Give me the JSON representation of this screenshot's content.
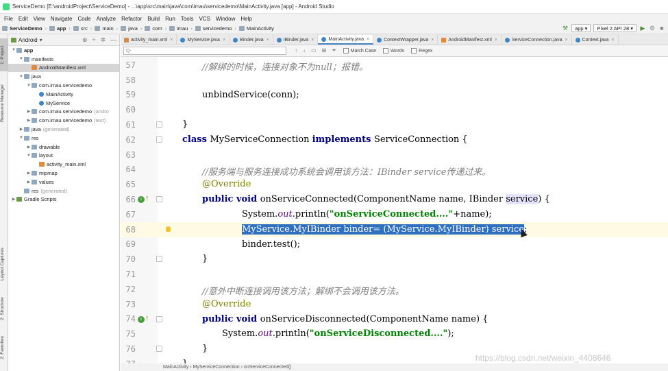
{
  "window": {
    "title": "ServiceDemo [E:\\androidProject\\ServiceDemo] - ...\\app\\src\\main\\java\\com\\imau\\servicedemo\\MainActivity.java [app] - Android Studio"
  },
  "menu": [
    "File",
    "Edit",
    "View",
    "Navigate",
    "Code",
    "Analyze",
    "Refactor",
    "Build",
    "Run",
    "Tools",
    "VCS",
    "Window",
    "Help"
  ],
  "breadcrumbs": [
    "ServiceDemo",
    "app",
    "src",
    "main",
    "java",
    "com",
    "imau",
    "servicedemo",
    "MainActivity"
  ],
  "toolbar": {
    "run_config": "app",
    "device": "Pixel 2 API 28"
  },
  "left_tools": [
    "1: Project",
    "Resource Manager",
    "Layout Captures",
    "2: Structure",
    "2: Favorites"
  ],
  "project_panel": {
    "view": "Android",
    "tree": [
      {
        "label": "app",
        "depth": 0,
        "arrow": "▼",
        "icon": "folder",
        "bold": true
      },
      {
        "label": "manifests",
        "depth": 1,
        "arrow": "▼",
        "icon": "folder"
      },
      {
        "label": "AndroidManifest.xml",
        "depth": 2,
        "arrow": "",
        "icon": "xml",
        "selected": true
      },
      {
        "label": "java",
        "depth": 1,
        "arrow": "▼",
        "icon": "folder"
      },
      {
        "label": "com.imau.servicedemo",
        "depth": 2,
        "arrow": "▼",
        "icon": "folder"
      },
      {
        "label": "MainActivity",
        "depth": 3,
        "arrow": "",
        "icon": "class"
      },
      {
        "label": "MyService",
        "depth": 3,
        "arrow": "",
        "icon": "class"
      },
      {
        "label": "com.imau.servicedemo",
        "suffix": "(andro",
        "depth": 2,
        "arrow": "▶",
        "icon": "folder"
      },
      {
        "label": "com.imau.servicedemo",
        "suffix": "(test)",
        "depth": 2,
        "arrow": "▶",
        "icon": "folder"
      },
      {
        "label": "java",
        "suffix": "(generated)",
        "depth": 1,
        "arrow": "▶",
        "icon": "folder"
      },
      {
        "label": "res",
        "depth": 1,
        "arrow": "▼",
        "icon": "folder"
      },
      {
        "label": "drawable",
        "depth": 2,
        "arrow": "▶",
        "icon": "folder"
      },
      {
        "label": "layout",
        "depth": 2,
        "arrow": "▼",
        "icon": "folder"
      },
      {
        "label": "activity_main.xml",
        "depth": 3,
        "arrow": "",
        "icon": "xml"
      },
      {
        "label": "mipmap",
        "depth": 2,
        "arrow": "▶",
        "icon": "folder"
      },
      {
        "label": "values",
        "depth": 2,
        "arrow": "▶",
        "icon": "folder"
      },
      {
        "label": "res",
        "suffix": "(generated)",
        "depth": 1,
        "arrow": "",
        "icon": "folder"
      },
      {
        "label": "Gradle Scripts",
        "depth": 0,
        "arrow": "▶",
        "icon": "gradle"
      }
    ]
  },
  "tabs": [
    {
      "label": "activity_main.xml",
      "icon": "xml",
      "active": false
    },
    {
      "label": "MyService.java",
      "icon": "class",
      "active": false
    },
    {
      "label": "Binder.java",
      "icon": "class",
      "active": false
    },
    {
      "label": "IBinder.java",
      "icon": "class",
      "active": false
    },
    {
      "label": "MainActivity.java",
      "icon": "class",
      "active": true
    },
    {
      "label": "ContextWrapper.java",
      "icon": "class",
      "active": false
    },
    {
      "label": "AndroidManifest.xml",
      "icon": "xml",
      "active": false
    },
    {
      "label": "ServiceConnection.java",
      "icon": "class",
      "active": false
    },
    {
      "label": "Context.java",
      "icon": "class",
      "active": false
    }
  ],
  "search": {
    "placeholder": "Q-",
    "match_case": "Match Case",
    "words": "Words",
    "regex": "Regex"
  },
  "code_lines": [
    {
      "n": "57",
      "indent": 2,
      "parts": [
        {
          "t": "//解绑的时候，连接对象不为null；报错。",
          "c": "cm"
        }
      ]
    },
    {
      "n": "58",
      "indent": 0,
      "parts": []
    },
    {
      "n": "59",
      "indent": 2,
      "parts": [
        {
          "t": "unbindService(conn);",
          "c": ""
        }
      ]
    },
    {
      "n": "60",
      "indent": 0,
      "parts": []
    },
    {
      "n": "61",
      "indent": 1,
      "parts": [
        {
          "t": "}",
          "c": ""
        }
      ],
      "fold": true
    },
    {
      "n": "62",
      "indent": 1,
      "parts": [
        {
          "t": "class ",
          "c": "kw"
        },
        {
          "t": "MyServiceConnection ",
          "c": ""
        },
        {
          "t": "implements ",
          "c": "kw"
        },
        {
          "t": "ServiceConnection {",
          "c": ""
        }
      ],
      "fold": true
    },
    {
      "n": "63",
      "indent": 0,
      "parts": []
    },
    {
      "n": "64",
      "indent": 2,
      "parts": [
        {
          "t": "//服务端与服务连接成功系统会调用该方法：IBinder service传递过来。",
          "c": "cm"
        }
      ]
    },
    {
      "n": "65",
      "indent": 2,
      "parts": [
        {
          "t": "@Override",
          "c": "an"
        }
      ]
    },
    {
      "n": "66",
      "indent": 2,
      "parts": [
        {
          "t": "public void ",
          "c": "kw"
        },
        {
          "t": "onServiceConnected(ComponentName name, IBinder ",
          "c": ""
        },
        {
          "t": "service",
          "c": "hl2"
        },
        {
          "t": ") {",
          "c": ""
        }
      ],
      "override": true,
      "fold": true
    },
    {
      "n": "67",
      "indent": 4,
      "parts": [
        {
          "t": "System.",
          "c": ""
        },
        {
          "t": "out",
          "c": "sf"
        },
        {
          "t": ".println(",
          "c": ""
        },
        {
          "t": "\"onServiceConnected....\"",
          "c": "st"
        },
        {
          "t": "+name);",
          "c": ""
        }
      ]
    },
    {
      "n": "68",
      "indent": 4,
      "parts": [
        {
          "t": "MyService.MyIBinder binder= (MyService.MyIBinder) service",
          "c": "hl"
        },
        {
          "t": ";",
          "c": ""
        }
      ],
      "current": true,
      "bulb": true
    },
    {
      "n": "69",
      "indent": 4,
      "parts": [
        {
          "t": "binder.test();",
          "c": ""
        }
      ]
    },
    {
      "n": "70",
      "indent": 2,
      "parts": [
        {
          "t": "}",
          "c": ""
        }
      ],
      "fold": true
    },
    {
      "n": "71",
      "indent": 0,
      "parts": []
    },
    {
      "n": "72",
      "indent": 2,
      "parts": [
        {
          "t": "//意外中断连接调用该方法；解绑不会调用该方法。",
          "c": "cm"
        }
      ]
    },
    {
      "n": "73",
      "indent": 2,
      "parts": [
        {
          "t": "@Override",
          "c": "an"
        }
      ]
    },
    {
      "n": "74",
      "indent": 2,
      "parts": [
        {
          "t": "public void ",
          "c": "kw"
        },
        {
          "t": "onServiceDisconnected(ComponentName name) {",
          "c": ""
        }
      ],
      "override": true,
      "fold": true
    },
    {
      "n": "75",
      "indent": 3,
      "parts": [
        {
          "t": "System.",
          "c": ""
        },
        {
          "t": "out",
          "c": "sf"
        },
        {
          "t": ".println(",
          "c": ""
        },
        {
          "t": "\"onServiceDisconnected....\"",
          "c": "st"
        },
        {
          "t": ");",
          "c": ""
        }
      ]
    },
    {
      "n": "76",
      "indent": 2,
      "parts": [
        {
          "t": "}",
          "c": ""
        }
      ],
      "fold": true
    },
    {
      "n": "77",
      "indent": 1,
      "parts": [
        {
          "t": "}",
          "c": ""
        }
      ]
    }
  ],
  "status": {
    "breadcrumb": "MainActivity  ›  MyServiceConnection  ›  onServiceConnected()"
  },
  "watermark": "https://blog.csdn.net/weixin_4408646"
}
